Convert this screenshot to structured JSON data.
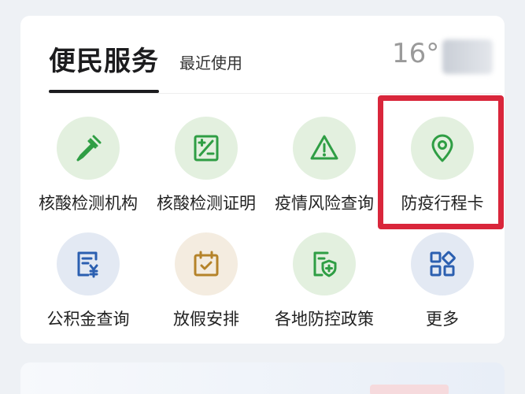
{
  "header": {
    "active_tab": "便民服务",
    "recent_tab": "最近使用",
    "weather_temp": "16°"
  },
  "services": [
    {
      "label": "核酸检测机构",
      "icon": "dropper-icon",
      "color": "#2f9e44"
    },
    {
      "label": "核酸检测证明",
      "icon": "certificate-icon",
      "color": "#2f9e44"
    },
    {
      "label": "疫情风险查询",
      "icon": "warning-icon",
      "color": "#2f9e44"
    },
    {
      "label": "防疫行程卡",
      "icon": "location-pin-icon",
      "color": "#2f9e44"
    },
    {
      "label": "公积金查询",
      "icon": "fund-document-icon",
      "color": "#2b5fb0"
    },
    {
      "label": "放假安排",
      "icon": "calendar-check-icon",
      "color": "#b5832a"
    },
    {
      "label": "各地防控政策",
      "icon": "shield-document-icon",
      "color": "#2f9e44"
    },
    {
      "label": "更多",
      "icon": "grid-more-icon",
      "color": "#2b5fb0"
    }
  ],
  "colors": {
    "highlight": "#d9263b",
    "green": "#2f9e44",
    "blue": "#2b5fb0",
    "orange": "#b5832a"
  }
}
